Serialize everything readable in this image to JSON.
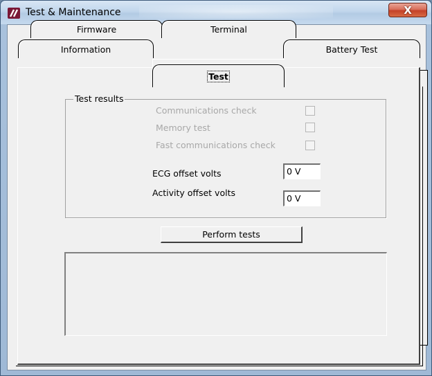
{
  "window": {
    "title": "Test & Maintenance",
    "icon": "app-logo-icon",
    "close_symbol": "X"
  },
  "tabs": {
    "row_back": [
      {
        "label": "Firmware"
      },
      {
        "label": "Terminal"
      }
    ],
    "row_front": [
      {
        "label": "Information"
      },
      {
        "label": "Test",
        "active": true
      },
      {
        "label": "Battery Test"
      }
    ]
  },
  "test_results": {
    "group_label": "Test results",
    "checks": [
      {
        "label": "Communications check",
        "checked": false,
        "enabled": false
      },
      {
        "label": "Memory test",
        "checked": false,
        "enabled": false
      },
      {
        "label": "Fast communications check",
        "checked": false,
        "enabled": false
      }
    ],
    "ecg_offset": {
      "label": "ECG offset volts",
      "value": "0 V"
    },
    "activity_offset": {
      "label": "Activity offset volts",
      "value": "0 V"
    }
  },
  "actions": {
    "perform_tests_label": "Perform tests"
  },
  "output": {
    "text": ""
  },
  "colors": {
    "title_bar": "#c1d6ec",
    "close_button": "#c34128",
    "dialog_background": "#f0f0f0",
    "disabled_text": "#a8a8a8"
  }
}
